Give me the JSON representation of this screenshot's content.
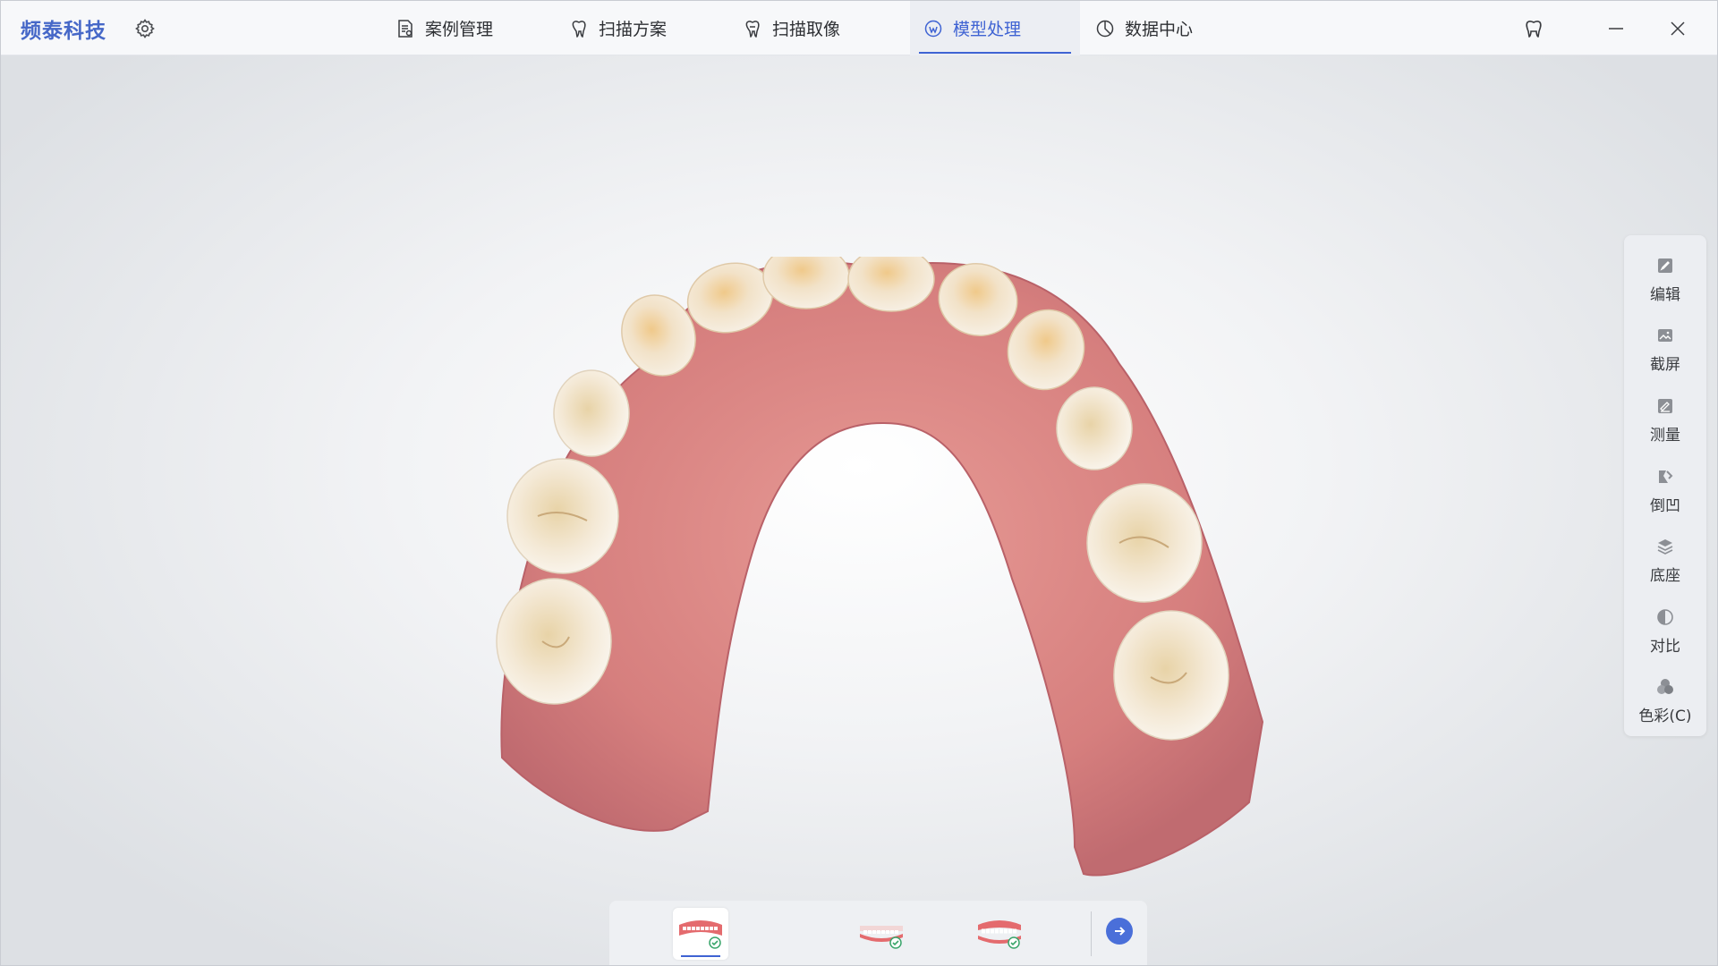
{
  "app": {
    "brand": "频泰科技"
  },
  "nav": {
    "tabs": [
      {
        "label": "案例管理",
        "icon": "case-document-icon",
        "active": false
      },
      {
        "label": "扫描方案",
        "icon": "tooth-plan-icon",
        "active": false
      },
      {
        "label": "扫描取像",
        "icon": "tooth-scan-icon",
        "active": false
      },
      {
        "label": "模型处理",
        "icon": "model-process-icon",
        "active": true
      },
      {
        "label": "数据中心",
        "icon": "pie-chart-icon",
        "active": false
      }
    ]
  },
  "tools": [
    {
      "label": "编辑",
      "icon": "edit-icon"
    },
    {
      "label": "截屏",
      "icon": "screenshot-icon"
    },
    {
      "label": "测量",
      "icon": "measure-icon"
    },
    {
      "label": "倒凹",
      "icon": "undercut-icon"
    },
    {
      "label": "底座",
      "icon": "base-layers-icon"
    },
    {
      "label": "对比",
      "icon": "contrast-icon"
    },
    {
      "label": "色彩(C)",
      "icon": "color-icon"
    }
  ],
  "jaws": [
    {
      "name": "upper-jaw",
      "active": true,
      "done": true
    },
    {
      "name": "lower-jaw",
      "active": false,
      "done": true
    },
    {
      "name": "bite",
      "active": false,
      "done": true
    }
  ],
  "colors": {
    "accent": "#3f63d3",
    "brand": "#4668c8",
    "gum": "#d98383",
    "tooth": "#f1e4cf"
  }
}
